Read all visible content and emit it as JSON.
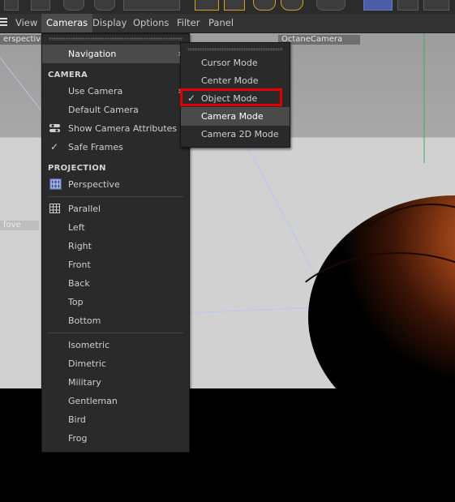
{
  "menubar": {
    "items": [
      "View",
      "Cameras",
      "Display",
      "Options",
      "Filter",
      "Panel"
    ],
    "active": "Cameras"
  },
  "viewport": {
    "left_label": "erspective",
    "right_label": "OctaneCamera",
    "side_label": "fove"
  },
  "cameras_menu": {
    "navigation": "Navigation",
    "section_camera": "CAMERA",
    "use_camera": "Use Camera",
    "default_camera": "Default Camera",
    "show_camera_attributes": "Show Camera Attributes",
    "safe_frames": "Safe Frames",
    "section_projection": "PROJECTION",
    "perspective": "Perspective",
    "parallel": "Parallel",
    "left": "Left",
    "right": "Right",
    "front": "Front",
    "back": "Back",
    "top": "Top",
    "bottom": "Bottom",
    "isometric": "Isometric",
    "dimetric": "Dimetric",
    "military": "Military",
    "gentleman": "Gentleman",
    "bird": "Bird",
    "frog": "Frog"
  },
  "navigation_submenu": {
    "cursor_mode": "Cursor Mode",
    "center_mode": "Center Mode",
    "object_mode": "Object Mode",
    "camera_mode": "Camera Mode",
    "camera_2d_mode": "Camera 2D Mode",
    "checked": "Object Mode",
    "hovered": "Camera Mode"
  },
  "icons": {
    "check": "✓",
    "submenu_arrow": "›"
  },
  "colors": {
    "highlight_box": "#e00000",
    "accent_blue": "#4a5fa8"
  }
}
